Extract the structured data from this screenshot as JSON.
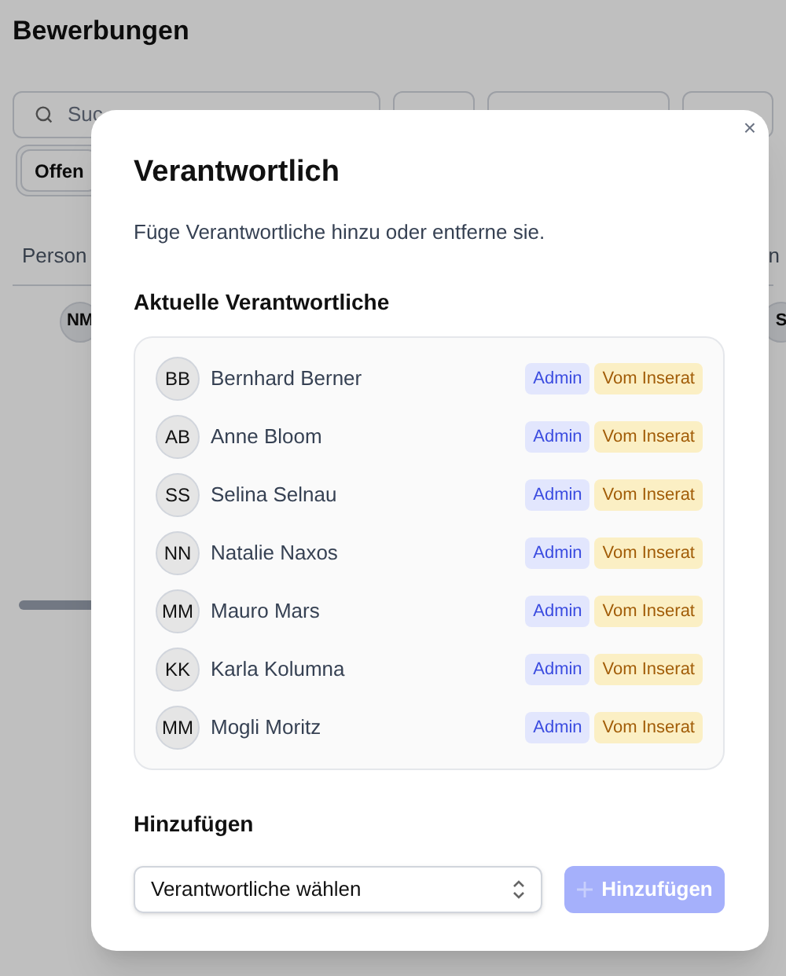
{
  "page": {
    "title": "Bewerbungen",
    "search": {
      "placeholder": "Suc"
    },
    "filter": {
      "label": "Offen"
    },
    "table": {
      "columns": [
        "Person",
        "n"
      ],
      "row": {
        "avatar": "NM",
        "avatar_right": "S"
      }
    }
  },
  "dialog": {
    "close": "×",
    "title": "Verantwortlich",
    "description": "Füge Verantwortliche hinzu oder entferne sie.",
    "current": {
      "heading": "Aktuelle Verantwortliche",
      "members": [
        {
          "initials": "BB",
          "name": "Bernhard Berner",
          "badges": [
            {
              "label": "Admin",
              "kind": "role"
            },
            {
              "label": "Vom Inserat",
              "kind": "source"
            }
          ]
        },
        {
          "initials": "AB",
          "name": "Anne Bloom",
          "badges": [
            {
              "label": "Admin",
              "kind": "role"
            },
            {
              "label": "Vom Inserat",
              "kind": "source"
            }
          ]
        },
        {
          "initials": "SS",
          "name": "Selina Selnau",
          "badges": [
            {
              "label": "Admin",
              "kind": "role"
            },
            {
              "label": "Vom Inserat",
              "kind": "source"
            }
          ]
        },
        {
          "initials": "NN",
          "name": "Natalie Naxos",
          "badges": [
            {
              "label": "Admin",
              "kind": "role"
            },
            {
              "label": "Vom Inserat",
              "kind": "source"
            }
          ]
        },
        {
          "initials": "MM",
          "name": "Mauro Mars",
          "badges": [
            {
              "label": "Admin",
              "kind": "role"
            },
            {
              "label": "Vom Inserat",
              "kind": "source"
            }
          ]
        },
        {
          "initials": "KK",
          "name": "Karla Kolumna",
          "badges": [
            {
              "label": "Admin",
              "kind": "role"
            },
            {
              "label": "Vom Inserat",
              "kind": "source"
            }
          ]
        },
        {
          "initials": "MM",
          "name": "Mogli Moritz",
          "badges": [
            {
              "label": "Admin",
              "kind": "role"
            },
            {
              "label": "Vom Inserat",
              "kind": "source"
            }
          ]
        }
      ]
    },
    "add": {
      "heading": "Hinzufügen",
      "select": {
        "placeholder": "Verantwortliche wählen"
      },
      "button": {
        "label": "Hinzufügen",
        "disabled": true
      }
    }
  }
}
